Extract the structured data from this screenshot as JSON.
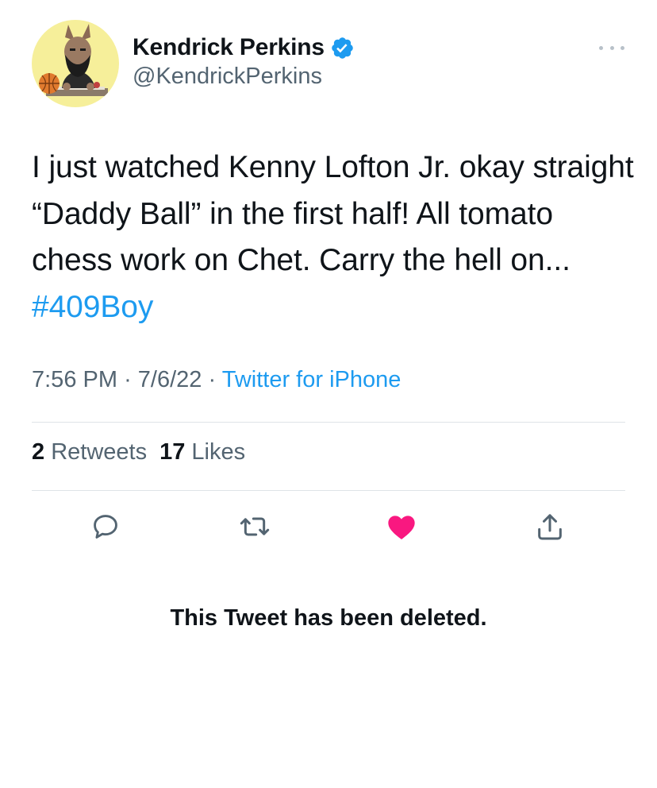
{
  "tweet": {
    "author": {
      "display_name": "Kendrick Perkins",
      "handle": "@KendrickPerkins",
      "verified": true,
      "avatar_background": "#f6ef9a"
    },
    "text_main": "I just watched Kenny Lofton Jr. okay straight “Daddy Ball” in the first half! All tomato chess work on Chet. Carry the hell on...",
    "hashtag": "#409Boy",
    "time": "7:56 PM",
    "date": "7/6/22",
    "separator": "·",
    "source": "Twitter for iPhone",
    "stats": {
      "retweets_count": "2",
      "retweets_label": "Retweets",
      "likes_count": "17",
      "likes_label": "Likes"
    },
    "actions": {
      "reply_icon": "comment-bubble-icon",
      "retweet_icon": "retweet-arrows-icon",
      "like_icon": "heart-filled-icon",
      "share_icon": "share-upload-icon",
      "liked": true
    },
    "deleted_notice": "This Tweet has been deleted."
  },
  "colors": {
    "link": "#1d9bf0",
    "secondary_text": "#536471",
    "primary_text": "#0f1419",
    "like": "#f91880",
    "divider": "#dfe3e7"
  }
}
